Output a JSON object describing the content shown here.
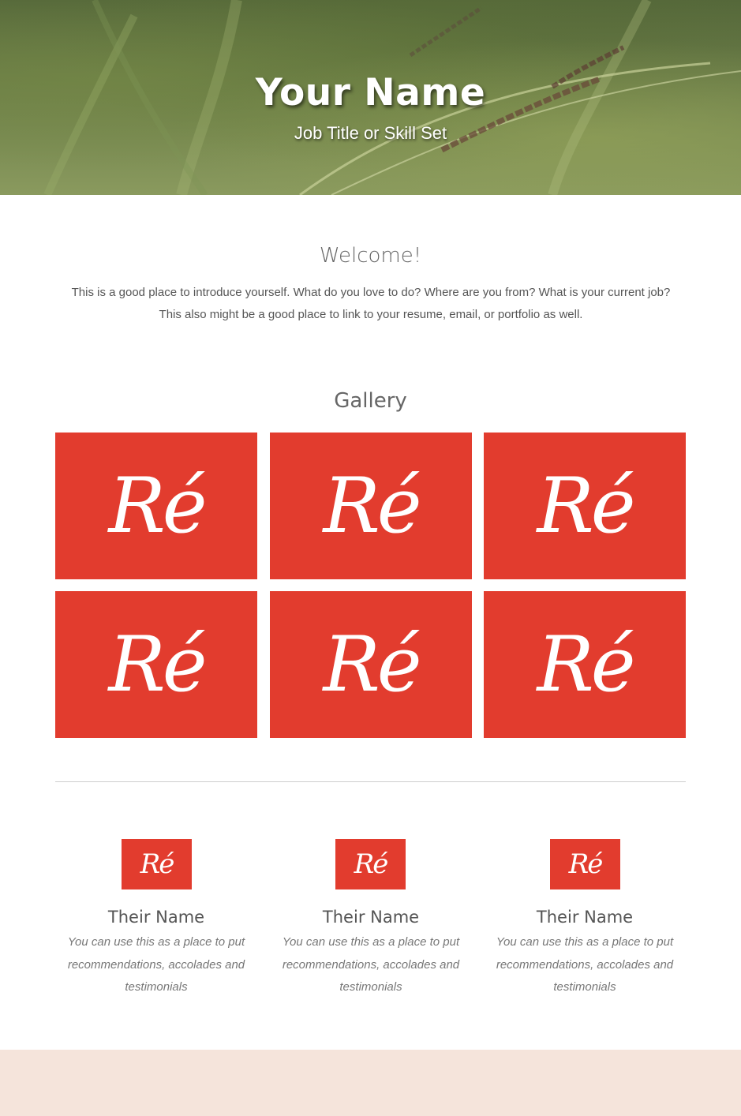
{
  "hero": {
    "name": "Your Name",
    "subtitle": "Job Title or Skill Set"
  },
  "welcome": {
    "title": "Welcome!",
    "text": "This is a good place to introduce yourself. What do you love to do? Where are you from? What is your current job? This also might be a good place to link to your resume, email, or portfolio as well."
  },
  "gallery": {
    "title": "Gallery",
    "logo_text": "Ré",
    "tile_color": "#e23c2e",
    "tiles": [
      "Ré",
      "Ré",
      "Ré",
      "Ré",
      "Ré",
      "Ré"
    ]
  },
  "testimonials": [
    {
      "logo": "Ré",
      "name": "Their Name",
      "text": "You can use this as a place to put recommendations, accolades and testimonials"
    },
    {
      "logo": "Ré",
      "name": "Their Name",
      "text": "You can use this as a place to put recommendations, accolades and testimonials"
    },
    {
      "logo": "Ré",
      "name": "Their Name",
      "text": "You can use this as a place to put recommendations, accolades and testimonials"
    }
  ],
  "colors": {
    "accent": "#e23c2e",
    "footer": "#f5e4db"
  }
}
